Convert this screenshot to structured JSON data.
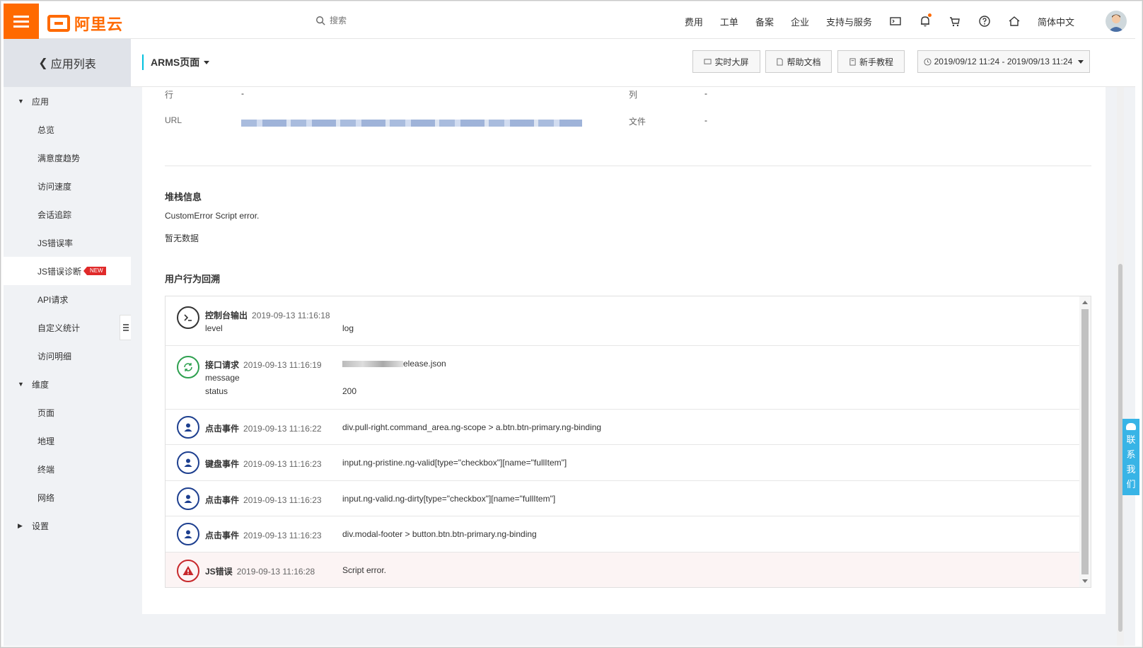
{
  "topbar": {
    "logo_text": "阿里云",
    "search_placeholder": "搜索",
    "nav": [
      "费用",
      "工单",
      "备案",
      "企业",
      "支持与服务"
    ],
    "language": "简体中文",
    "icons": [
      "terminal-icon",
      "bell-icon",
      "cart-icon",
      "help-icon",
      "home-icon"
    ]
  },
  "sidebar": {
    "back_label": "应用列表",
    "groups": [
      {
        "label": "应用",
        "expanded": true,
        "items": [
          "总览",
          "满意度趋势",
          "访问速度",
          "会话追踪",
          "JS错误率",
          "JS错误诊断",
          "API请求",
          "自定义统计",
          "访问明细"
        ]
      },
      {
        "label": "维度",
        "expanded": true,
        "items": [
          "页面",
          "地理",
          "终端",
          "网络"
        ]
      },
      {
        "label": "设置",
        "expanded": false,
        "items": []
      }
    ],
    "active_item": "JS错误诊断",
    "new_badge": "NEW"
  },
  "header": {
    "title": "ARMS页面",
    "buttons": {
      "realtime": "实时大屏",
      "help_doc": "帮助文档",
      "tutorial": "新手教程"
    },
    "time_range": "2019/09/12 11:24 - 2019/09/13 11:24"
  },
  "details": {
    "row_label": "行",
    "row_value": "-",
    "col_label": "列",
    "col_value": "-",
    "url_label": "URL",
    "file_label": "文件",
    "file_value": "-"
  },
  "stack": {
    "title": "堆栈信息",
    "error": "CustomError Script error.",
    "no_data": "暂无数据"
  },
  "behavior": {
    "title": "用户行为回溯",
    "events": [
      {
        "type": "控制台输出",
        "time": "2019-09-13 11:16:18",
        "icon": "console-icon",
        "fields": [
          {
            "key": "level",
            "value": "log"
          }
        ]
      },
      {
        "type": "接口请求",
        "time": "2019-09-13 11:16:19",
        "icon": "refresh-icon",
        "target": "elease.json",
        "fields": [
          {
            "key": "message",
            "value": ""
          },
          {
            "key": "status",
            "value": "200"
          }
        ]
      },
      {
        "type": "点击事件",
        "time": "2019-09-13 11:16:22",
        "icon": "user-icon",
        "target": "div.pull-right.command_area.ng-scope > a.btn.btn-primary.ng-binding"
      },
      {
        "type": "键盘事件",
        "time": "2019-09-13 11:16:23",
        "icon": "user-icon",
        "target": "input.ng-pristine.ng-valid[type=\"checkbox\"][name=\"fullItem\"]"
      },
      {
        "type": "点击事件",
        "time": "2019-09-13 11:16:23",
        "icon": "user-icon",
        "target": "input.ng-valid.ng-dirty[type=\"checkbox\"][name=\"fullItem\"]"
      },
      {
        "type": "点击事件",
        "time": "2019-09-13 11:16:23",
        "icon": "user-icon",
        "target": "div.modal-footer > button.btn.btn-primary.ng-binding"
      },
      {
        "type": "JS错误",
        "time": "2019-09-13 11:16:28",
        "icon": "warning-icon",
        "target": "Script error."
      }
    ]
  },
  "contact": {
    "label_chars": [
      "联",
      "系",
      "我",
      "们"
    ]
  },
  "colors": {
    "brand": "#ff6a00",
    "accent": "#00c1de",
    "user_icon": "#1d3f8f",
    "success": "#2ea04f",
    "error": "#c7282b",
    "contact": "#38b4e6"
  }
}
